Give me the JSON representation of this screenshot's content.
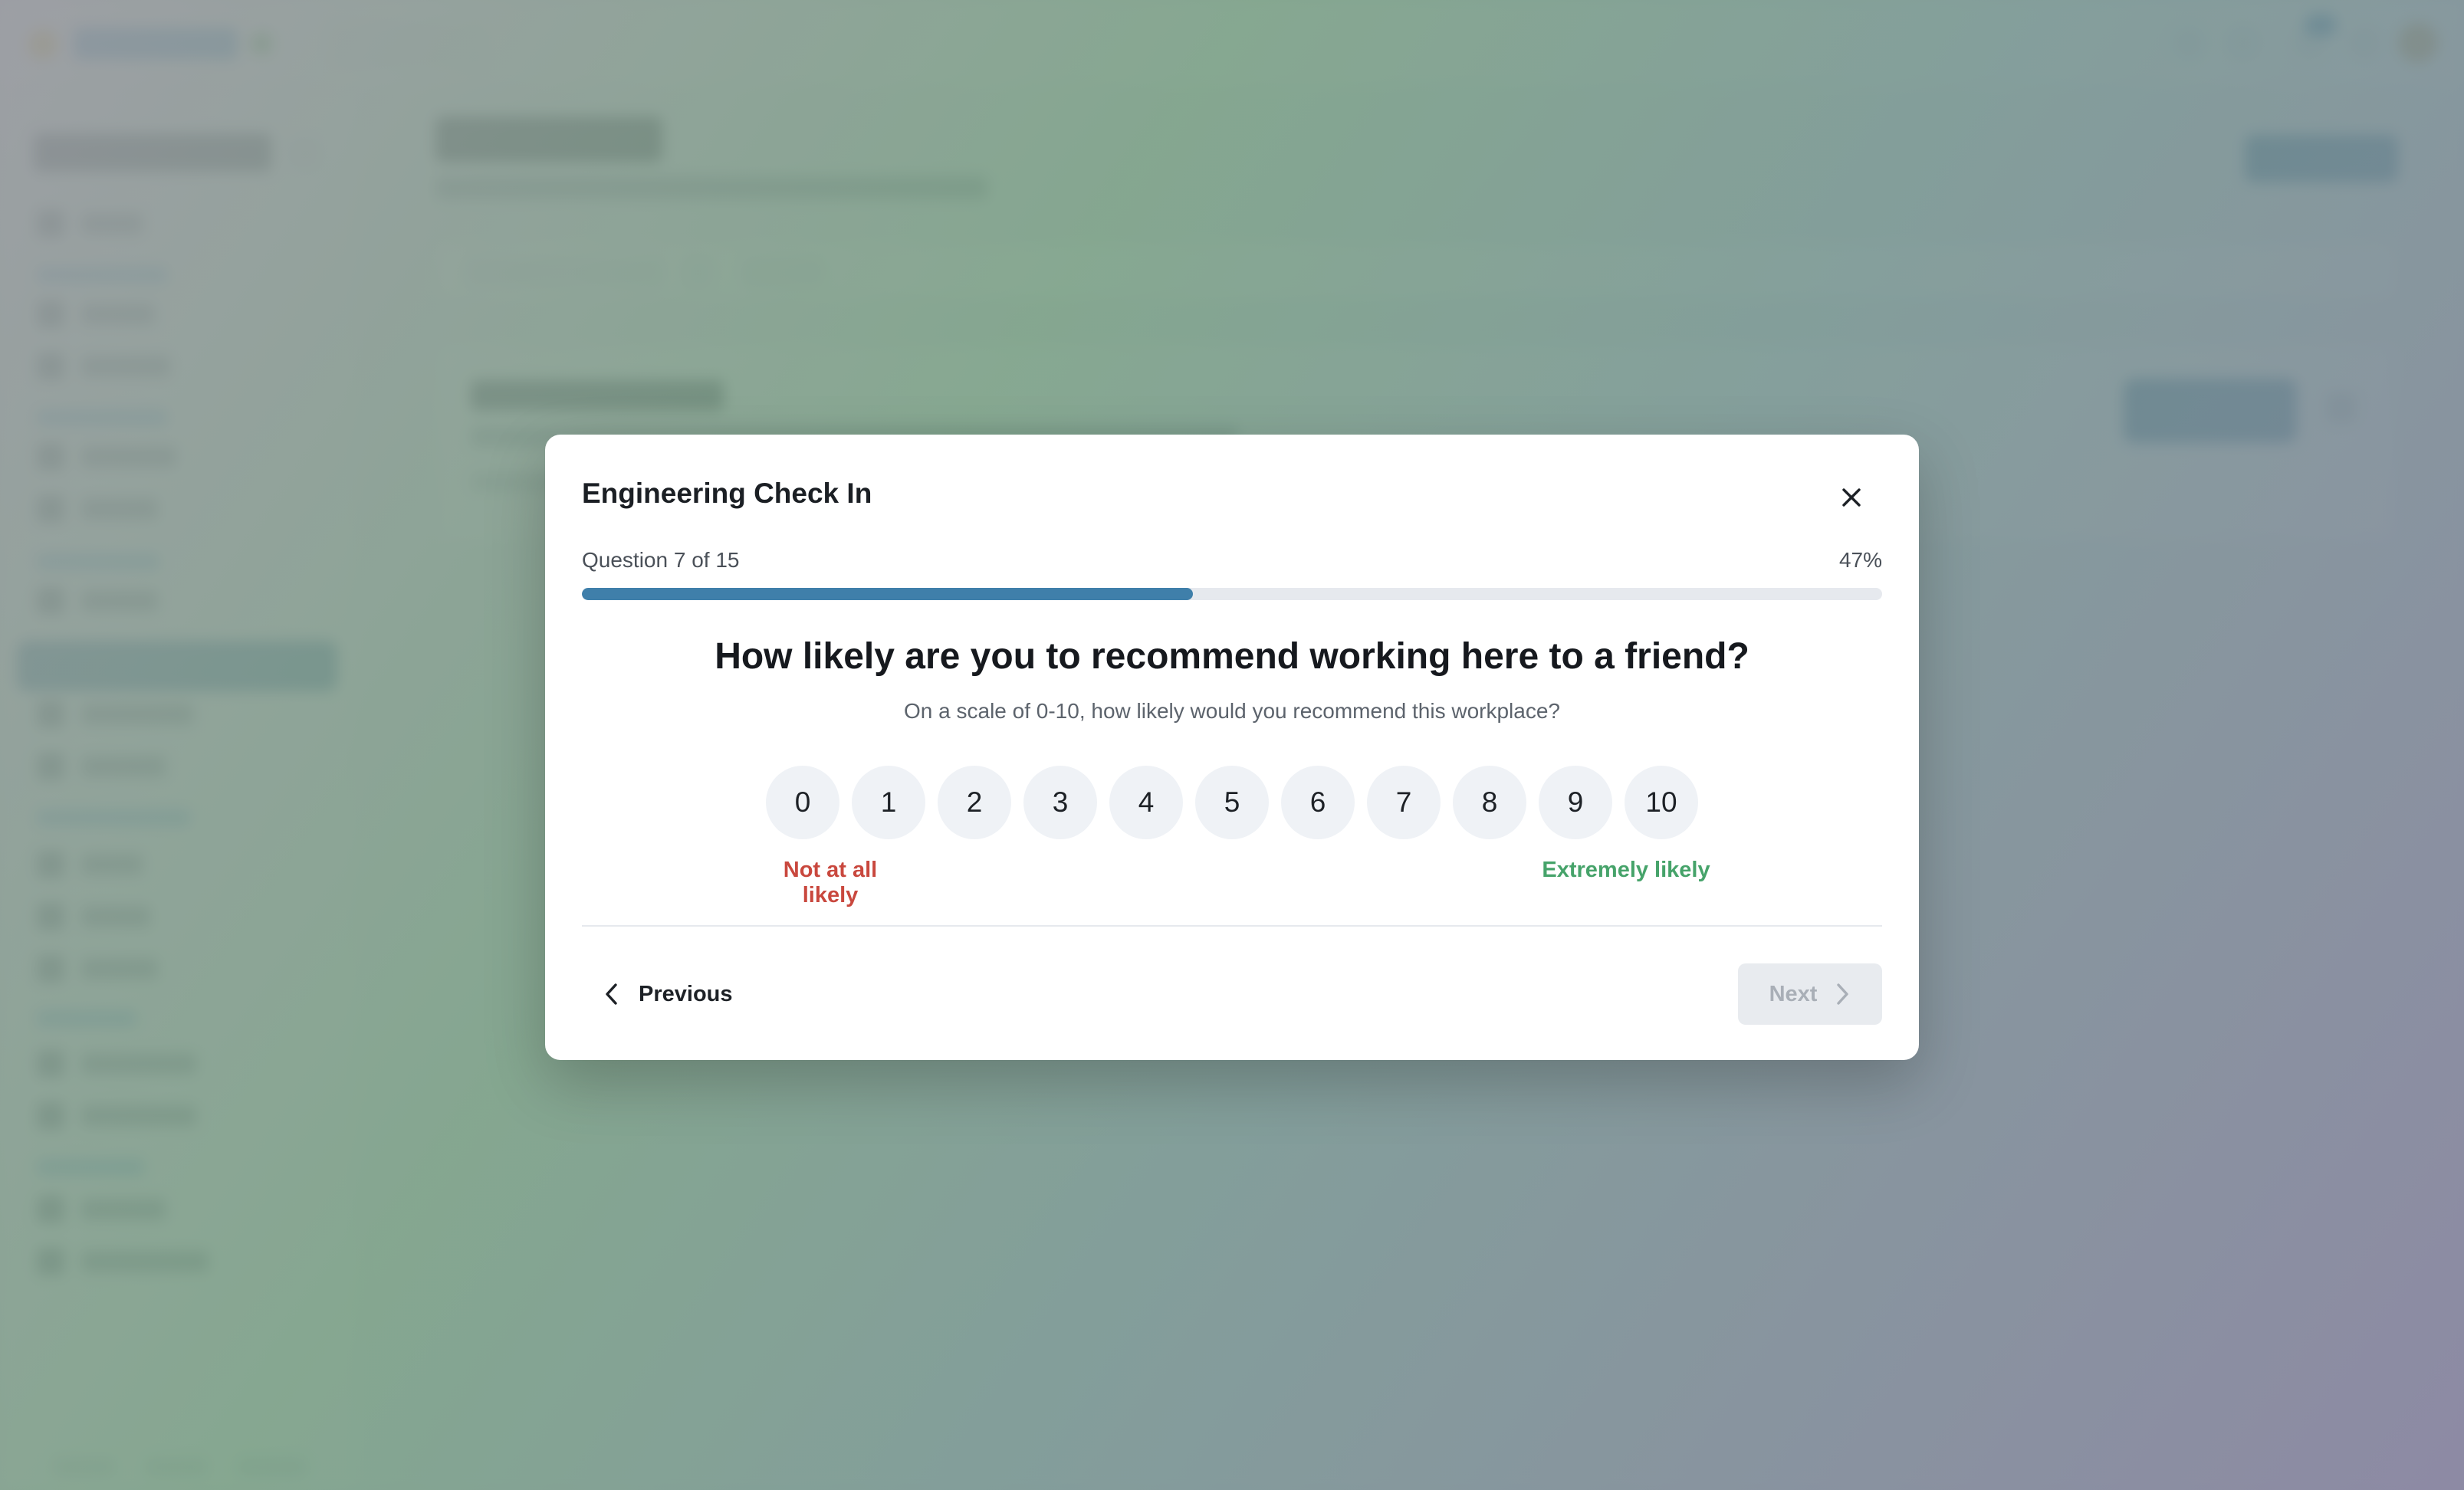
{
  "modal": {
    "title": "Engineering Check In",
    "progress": {
      "label": "Question 7 of 15",
      "percent_text": "47%",
      "fraction": 0.47
    },
    "question": "How likely are you to recommend working here to a friend?",
    "help_text": "On a scale of 0-10, how likely would you recommend this workplace?",
    "scale": {
      "options": [
        "0",
        "1",
        "2",
        "3",
        "4",
        "5",
        "6",
        "7",
        "8",
        "9",
        "10"
      ],
      "low_label": "Not at all likely",
      "high_label": "Extremely likely"
    },
    "previous_label": "Previous",
    "next_label": "Next"
  },
  "icons": {
    "close": "close-icon",
    "previous": "chevron-left-icon",
    "next": "chevron-right-icon"
  },
  "colors": {
    "accent": "#3f7faa",
    "low": "#c9483e",
    "high": "#46a36a"
  }
}
